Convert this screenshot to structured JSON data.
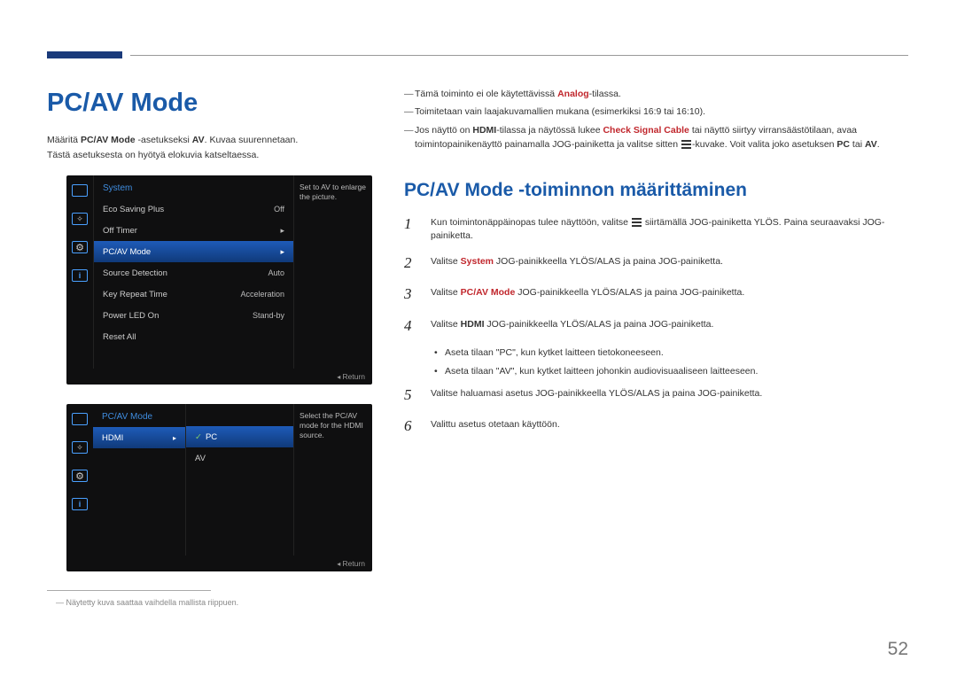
{
  "page": {
    "title": "PC/AV Mode",
    "number": "52"
  },
  "intro": {
    "line1_pre": "Määritä ",
    "line1_bold": "PC/AV Mode",
    "line1_mid": " -asetukseksi ",
    "line1_bold2": "AV",
    "line1_post": ". Kuvaa suurennetaan.",
    "line2": "Tästä asetuksesta on hyötyä elokuvia katseltaessa."
  },
  "osd1": {
    "header": "System",
    "hint": "Set to AV to enlarge the picture.",
    "rows": [
      {
        "label": "Eco Saving Plus",
        "value": "Off"
      },
      {
        "label": "Off Timer",
        "value": "▸"
      },
      {
        "label": "PC/AV Mode",
        "value": "▸",
        "selected": true
      },
      {
        "label": "Source Detection",
        "value": "Auto"
      },
      {
        "label": "Key Repeat Time",
        "value": "Acceleration"
      },
      {
        "label": "Power LED On",
        "value": "Stand-by"
      },
      {
        "label": "Reset All",
        "value": ""
      }
    ],
    "footer": "Return"
  },
  "osd2": {
    "header": "PC/AV Mode",
    "left_item": "HDMI",
    "hint": "Select the PC/AV mode for the HDMI source.",
    "options": [
      {
        "label": "PC",
        "checked": true,
        "selected": true
      },
      {
        "label": "AV"
      }
    ],
    "footer": "Return"
  },
  "footnote": "Näytetty kuva saattaa vaihdella mallista riippuen.",
  "right_notes": {
    "n1_pre": "Tämä toiminto ei ole käytettävissä ",
    "n1_red": "Analog",
    "n1_post": "-tilassa.",
    "n2": "Toimitetaan vain laajakuvamallien mukana (esimerkiksi 16:9 tai 16:10).",
    "n3_a": "Jos näyttö on ",
    "n3_b": "HDMI",
    "n3_c": "-tilassa ja näytössä lukee ",
    "n3_d": "Check Signal Cable",
    "n3_e": " tai näyttö siirtyy virransäästötilaan, avaa toimintopainikenäyttö painamalla JOG-painiketta ja valitse sitten ",
    "n3_f": "-kuvake. Voit valita joko asetuksen ",
    "n3_g": "PC",
    "n3_h": " tai ",
    "n3_i": "AV",
    "n3_j": "."
  },
  "section_title": "PC/AV Mode -toiminnon määrittäminen",
  "steps": [
    {
      "num": "1",
      "pre": "Kun toimintonäppäinopas tulee näyttöön, valitse ",
      "post": " siirtämällä JOG-painiketta YLÖS. Paina seuraavaksi JOG-painiketta.",
      "has_icon": true
    },
    {
      "num": "2",
      "pre": "Valitse ",
      "red": "System",
      "post": " JOG-painikkeella YLÖS/ALAS ja paina JOG-painiketta."
    },
    {
      "num": "3",
      "pre": "Valitse ",
      "red": "PC/AV Mode",
      "post": " JOG-painikkeella YLÖS/ALAS ja paina JOG-painiketta."
    },
    {
      "num": "4",
      "pre": "Valitse ",
      "bold": "HDMI",
      "post": " JOG-painikkeella YLÖS/ALAS ja paina JOG-painiketta."
    }
  ],
  "bullets": [
    "Aseta tilaan \"PC\", kun kytket laitteen tietokoneeseen.",
    "Aseta tilaan \"AV\", kun kytket laitteen johonkin audiovisuaaliseen laitteeseen."
  ],
  "steps2": [
    {
      "num": "5",
      "text": "Valitse haluamasi asetus JOG-painikkeella YLÖS/ALAS ja paina JOG-painiketta."
    },
    {
      "num": "6",
      "text": "Valittu asetus otetaan käyttöön."
    }
  ]
}
